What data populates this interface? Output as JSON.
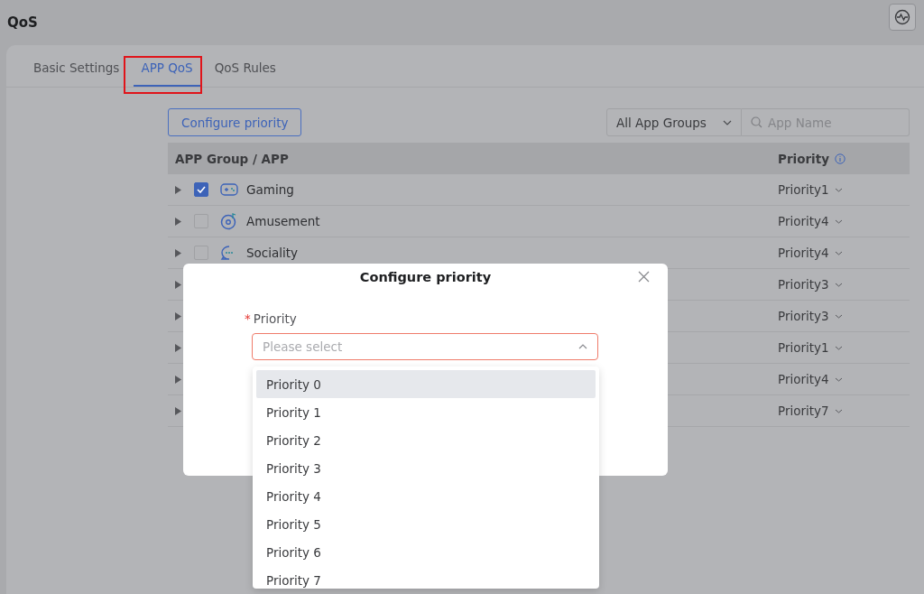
{
  "page": {
    "title": "QoS"
  },
  "tabs": [
    {
      "label": "Basic Settings",
      "selected": false
    },
    {
      "label": "APP QoS",
      "selected": true
    },
    {
      "label": "QoS Rules",
      "selected": false
    }
  ],
  "toolbar": {
    "button": "Configure priority",
    "group_filter": "All App Groups",
    "search": {
      "placeholder": "App Name"
    }
  },
  "table": {
    "columns": [
      "APP Group / APP",
      "Priority"
    ],
    "rows": [
      {
        "name": "Gaming",
        "checked": true,
        "priority": "Priority1"
      },
      {
        "name": "Amusement",
        "checked": false,
        "priority": "Priority4"
      },
      {
        "name": "Sociality",
        "checked": false,
        "priority": "Priority4"
      },
      {
        "priority": "Priority3"
      },
      {
        "priority": "Priority3"
      },
      {
        "priority": "Priority1"
      },
      {
        "priority": "Priority4"
      },
      {
        "priority": "Priority7"
      }
    ]
  },
  "dialog": {
    "title": "Configure priority",
    "field_label": "Priority",
    "required_mark": "*",
    "placeholder": "Please select",
    "options": [
      {
        "label": "Priority 0",
        "selected": true
      },
      {
        "label": "Priority 1",
        "selected": false
      },
      {
        "label": "Priority 2",
        "selected": false
      },
      {
        "label": "Priority 3",
        "selected": false
      },
      {
        "label": "Priority 4",
        "selected": false
      },
      {
        "label": "Priority 5",
        "selected": false
      },
      {
        "label": "Priority 6",
        "selected": false
      },
      {
        "label": "Priority 7",
        "selected": false
      }
    ]
  }
}
